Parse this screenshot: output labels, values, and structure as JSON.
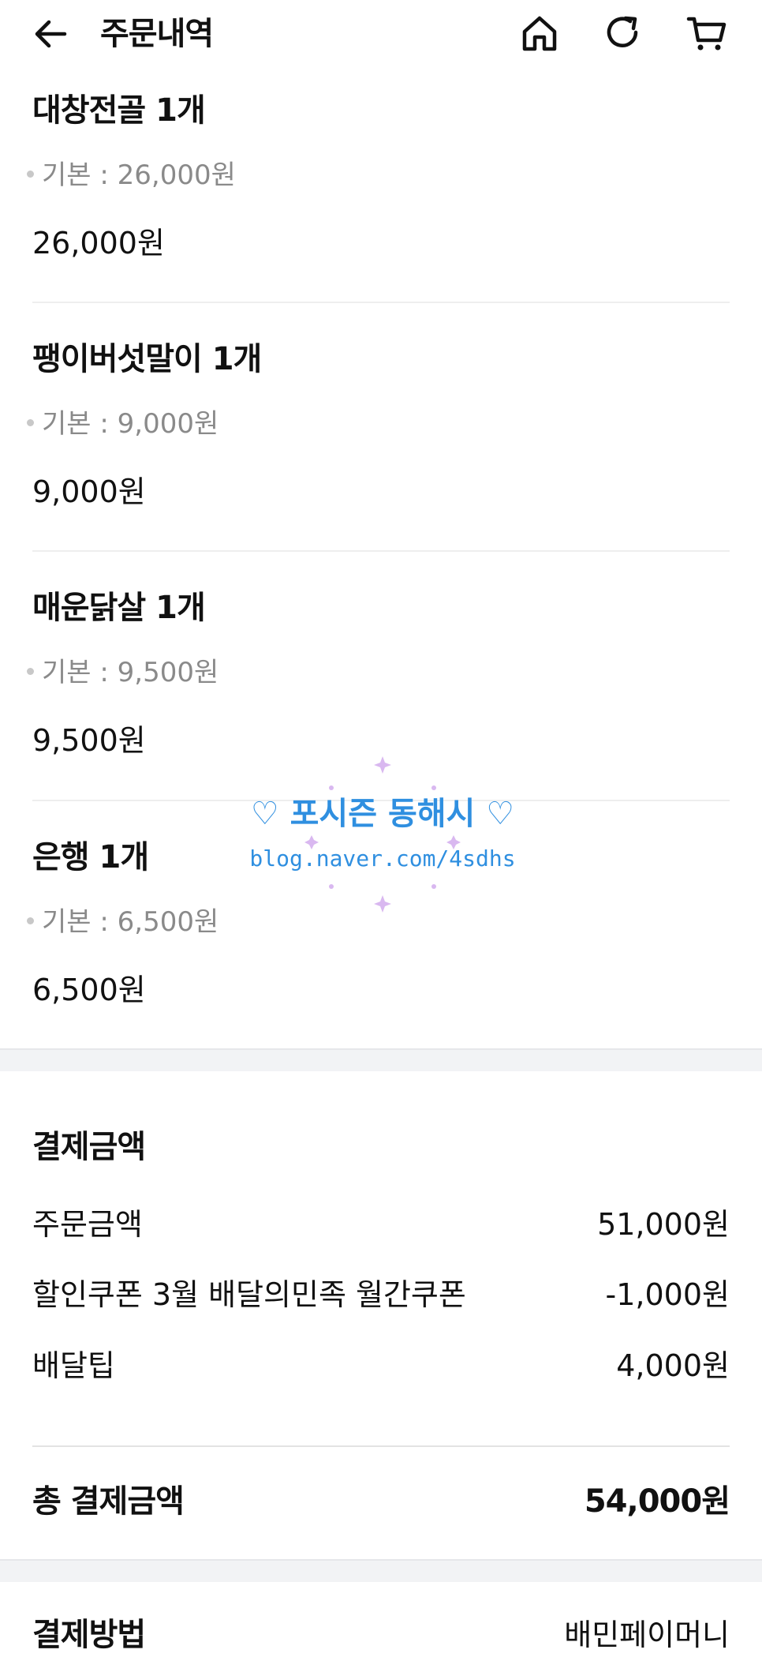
{
  "header": {
    "title": "주문내역"
  },
  "items": [
    {
      "name": "대창전골 1개",
      "option": "기본 : 26,000원",
      "price": "26,000원"
    },
    {
      "name": "팽이버섯말이 1개",
      "option": "기본 : 9,000원",
      "price": "9,000원"
    },
    {
      "name": "매운닭살 1개",
      "option": "기본 : 9,500원",
      "price": "9,500원"
    },
    {
      "name": "은행 1개",
      "option": "기본 : 6,500원",
      "price": "6,500원"
    }
  ],
  "payment_summary": {
    "title": "결제금액",
    "rows": [
      {
        "label": "주문금액",
        "value": "51,000원"
      },
      {
        "label": "할인쿠폰 3월 배달의민족 월간쿠폰",
        "value": "-1,000원"
      },
      {
        "label": "배달팁",
        "value": "4,000원"
      }
    ],
    "total_label": "총 결제금액",
    "total_value": "54,000원"
  },
  "payment_method": {
    "label": "결제방법",
    "value": "배민페이머니"
  },
  "watermark": {
    "title": "포시즌 동해시",
    "url": "blog.naver.com/4sdhs"
  },
  "icons": {
    "back": "back-arrow-icon",
    "home": "home-icon",
    "refresh": "refresh-icon",
    "cart": "cart-icon"
  },
  "colors": {
    "text": "#111111",
    "muted": "#8a8a8a",
    "section_bg": "#f2f3f5",
    "watermark": "#2f8fe0"
  }
}
